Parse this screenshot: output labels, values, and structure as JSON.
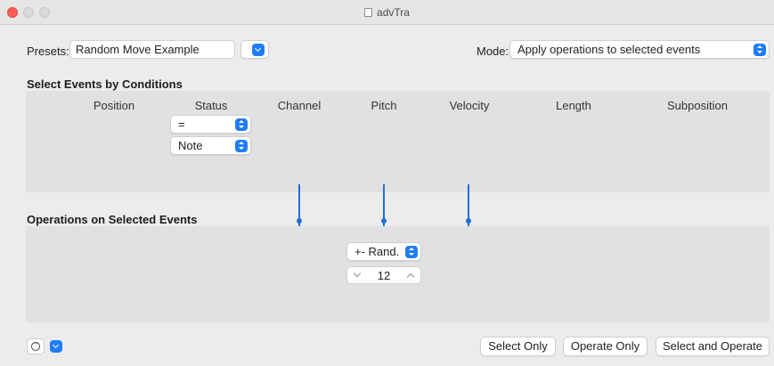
{
  "window": {
    "title": "advTra"
  },
  "presets": {
    "label": "Presets:",
    "value": "Random Move Example"
  },
  "mode": {
    "label": "Mode:",
    "value": "Apply operations to selected events"
  },
  "conditions": {
    "title": "Select Events by Conditions",
    "columns": [
      "Position",
      "Status",
      "Channel",
      "Pitch",
      "Velocity",
      "Length",
      "Subposition"
    ],
    "status_condition": "=",
    "status_value": "Note"
  },
  "operations": {
    "title": "Operations on Selected Events",
    "operation": "+- Rand.",
    "amount": "12"
  },
  "buttons": {
    "select_only": "Select Only",
    "operate_only": "Operate Only",
    "select_and_operate": "Select and Operate"
  },
  "colors": {
    "accent": "#1f7cf6",
    "line": "#1f6fd8",
    "panel": "#e1e1e1"
  },
  "icons": [
    "document-icon",
    "chevron-down-icon",
    "up-down-stepper-icon",
    "action-ellipsis-icon"
  ]
}
